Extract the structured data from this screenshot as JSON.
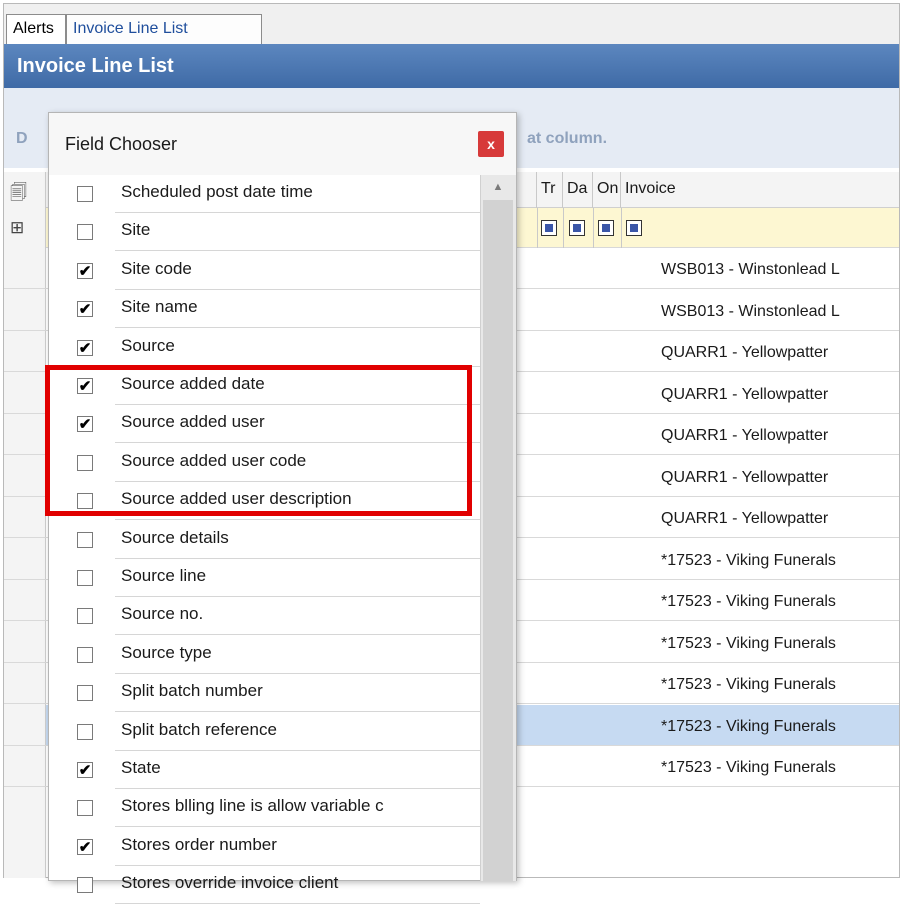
{
  "tabs": [
    {
      "label": "Alerts"
    },
    {
      "label": "Invoice Line List"
    }
  ],
  "panel": {
    "title": "Invoice Line List",
    "group_hint_left": "D",
    "group_hint_right": "at column."
  },
  "grid": {
    "headers": [
      "Tr",
      "Da",
      "On",
      "Invoice"
    ],
    "rows": [
      {
        "invoice": "WSB013 - Winstonlead L",
        "selected": false
      },
      {
        "invoice": "WSB013 - Winstonlead L",
        "selected": false
      },
      {
        "invoice": "QUARR1 - Yellowpatter",
        "selected": false
      },
      {
        "invoice": "QUARR1 - Yellowpatter",
        "selected": false
      },
      {
        "invoice": "QUARR1 - Yellowpatter",
        "selected": false
      },
      {
        "invoice": "QUARR1 - Yellowpatter",
        "selected": false
      },
      {
        "invoice": "QUARR1 - Yellowpatter",
        "selected": false
      },
      {
        "invoice": "*17523 - Viking Funerals",
        "selected": false
      },
      {
        "invoice": "*17523 - Viking Funerals",
        "selected": false
      },
      {
        "invoice": "*17523 - Viking Funerals",
        "selected": false
      },
      {
        "invoice": "*17523 - Viking Funerals",
        "selected": false
      },
      {
        "invoice": "*17523 - Viking Funerals",
        "selected": true
      },
      {
        "invoice": "*17523 - Viking Funerals",
        "selected": false
      }
    ]
  },
  "chooser": {
    "title": "Field Chooser",
    "close_label": "x",
    "items": [
      {
        "label": "Scheduled post date time",
        "checked": false
      },
      {
        "label": "Site",
        "checked": false
      },
      {
        "label": "Site code",
        "checked": true
      },
      {
        "label": "Site name",
        "checked": true
      },
      {
        "label": "Source",
        "checked": true
      },
      {
        "label": "Source added date",
        "checked": true
      },
      {
        "label": "Source added user",
        "checked": true
      },
      {
        "label": "Source added user code",
        "checked": false
      },
      {
        "label": "Source added user description",
        "checked": false
      },
      {
        "label": "Source details",
        "checked": false
      },
      {
        "label": "Source line",
        "checked": false
      },
      {
        "label": "Source no.",
        "checked": false
      },
      {
        "label": "Source type",
        "checked": false
      },
      {
        "label": "Split batch number",
        "checked": false
      },
      {
        "label": "Split batch reference",
        "checked": false
      },
      {
        "label": "State",
        "checked": true
      },
      {
        "label": "Stores blling line is allow variable c",
        "checked": false
      },
      {
        "label": "Stores order number",
        "checked": true
      },
      {
        "label": "Stores override invoice client",
        "checked": false
      }
    ]
  },
  "colors": {
    "title_bar": "#4a76b2",
    "highlight": "#e10000",
    "close_button": "#d73a3a",
    "selected_row": "#c6daf2"
  },
  "icons": {
    "column_chooser": "column-chooser-icon",
    "filter_clear": "filter-clear-icon",
    "scroll_up": "scroll-up-arrow-icon"
  }
}
